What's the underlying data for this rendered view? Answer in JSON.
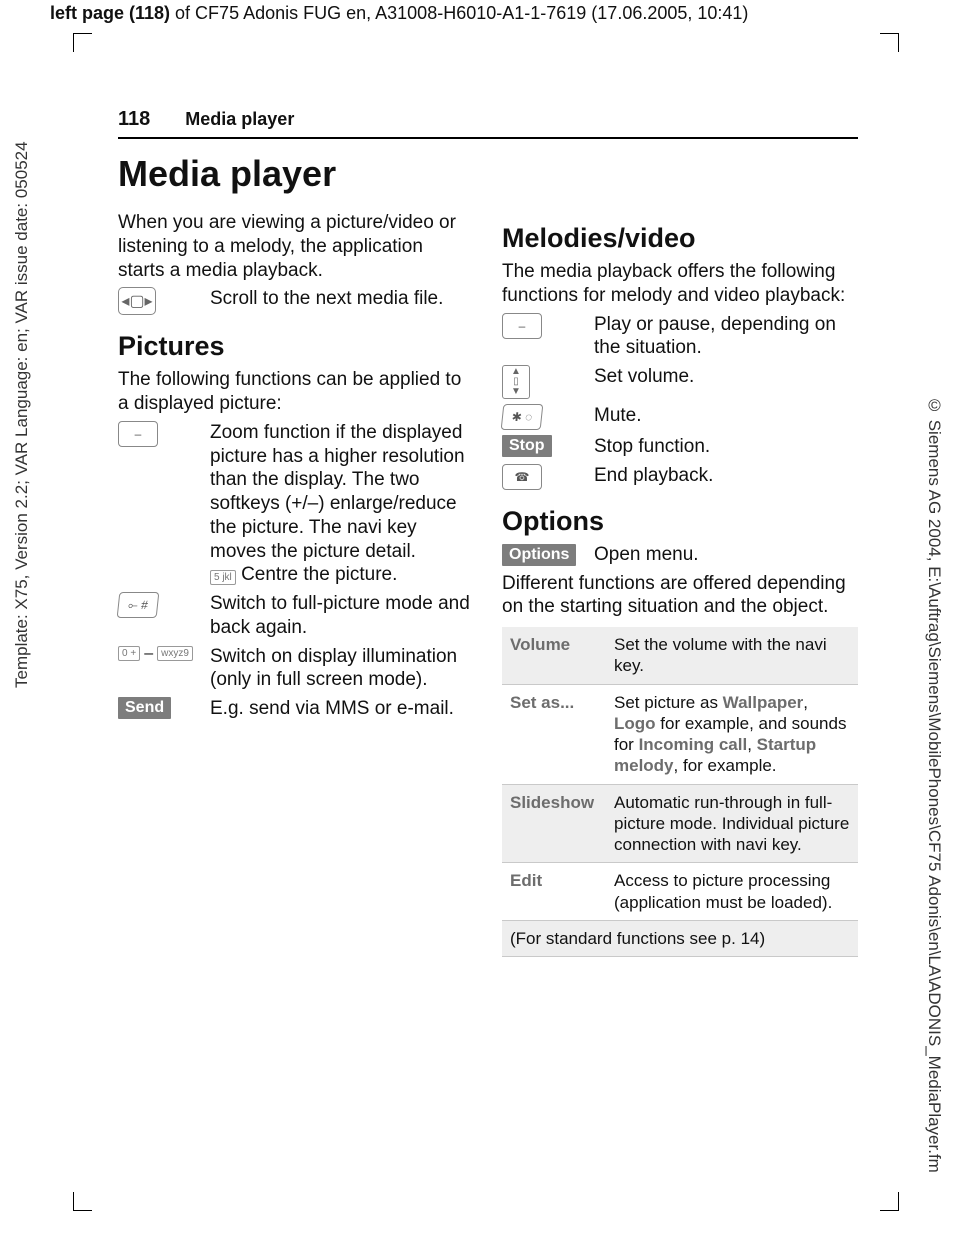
{
  "header_left": "left page (118)",
  "header_rest": " of CF75 Adonis FUG en, A31008-H6010-A1-1-7619 (17.06.2005, 10:41)",
  "side_left": "Template: X75, Version 2.2; VAR Language: en; VAR issue date: 050524",
  "side_right": "© Siemens AG 2004, E:\\Auftrag\\Siemens\\MobilePhones\\CF75 Adonis\\en\\LA\\ADONIS_MediaPlayer.fm",
  "page_no": "118",
  "run_head": "Media player",
  "title": "Media player",
  "intro": "When you are viewing a picture/video or listening to a melody, the application starts a media playback.",
  "scroll_next": "Scroll to the next media file.",
  "pic_h": "Pictures",
  "pic_intro": "The following functions can be applied to a displayed picture:",
  "pic_zoom": "Zoom function if the displayed picture has a higher resolution than the display. The two softkeys (+/–) enlarge/reduce the picture. The navi key moves the picture detail.",
  "pic_centre_key": "5 jkl",
  "pic_centre": "Centre the picture.",
  "pic_full": "Switch to full-picture mode and back again.",
  "pic_illum": "Switch on display illumination (only in full screen mode).",
  "pic_illum_k1": "0 +",
  "pic_illum_dash": "–",
  "pic_illum_k2": "wxyz9",
  "send_label": "Send",
  "pic_send": "E.g. send via MMS or e-mail.",
  "mel_h": "Melodies/video",
  "mel_intro": "The media playback offers the following functions for melody and video playback:",
  "mel_play": "Play or pause, depending on the situation.",
  "mel_vol": "Set volume.",
  "mel_mute": "Mute.",
  "stop_label": "Stop",
  "mel_stop": "Stop function.",
  "mel_end": "End playback.",
  "opt_h": "Options",
  "options_label": "Options",
  "opt_open": "Open menu.",
  "opt_intro": "Different functions are offered depending on the starting situation and the object.",
  "tbl": {
    "volume_k": "Volume",
    "volume_v": "Set the volume with the navi key.",
    "setas_k": "Set as...",
    "setas_pre": "Set picture as ",
    "wallpaper": "Wallpaper",
    "setas_mid1": ", ",
    "logo": "Logo",
    "setas_mid2": " for example, and sounds for ",
    "incoming": "Incoming call",
    "setas_mid3": ", ",
    "startup": "Startup melody",
    "setas_post": ", for example.",
    "slide_k": "Slideshow",
    "slide_v": "Automatic run-through in full-picture mode. Individual picture connection with navi key.",
    "edit_k": "Edit",
    "edit_v": "Access to picture processing (application must be loaded).",
    "foot": "(For standard functions see p. 14)"
  }
}
